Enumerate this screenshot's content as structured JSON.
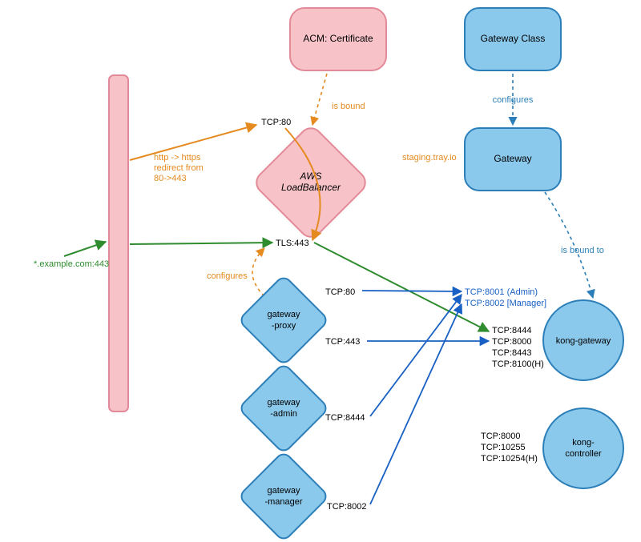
{
  "nodes": {
    "acm_cert": "ACM: Certificate",
    "aws_lb": "AWS\nLoadBalancer",
    "gateway_class": "Gateway Class",
    "gateway": "Gateway",
    "gateway_proxy": "gateway\n-proxy",
    "gateway_admin": "gateway\n-admin",
    "gateway_manager": "gateway\n-manager",
    "kong_gateway": "kong-gateway",
    "kong_controller": "kong-\ncontroller"
  },
  "ports": {
    "lb_tcp80": "TCP:80",
    "lb_tls443": "TLS:443",
    "proxy_tcp80": "TCP:80",
    "proxy_tcp443": "TCP:443",
    "admin_tcp8444": "TCP:8444",
    "manager_tcp8002": "TCP:8002",
    "kg_admin": "TCP:8001 (Admin)",
    "kg_manager": "TCP:8002 [Manager]",
    "kg_8444": "TCP:8444",
    "kg_8000": "TCP:8000",
    "kg_8443": "TCP:8443",
    "kg_8100": "TCP:8100(H)",
    "kc_8000": "TCP:8000",
    "kc_10255": "TCP:10255",
    "kc_10254": "TCP:10254(H)"
  },
  "labels": {
    "ingress": "*.example.com:443",
    "http_redirect": "http -> https\nredirect from\n80->443",
    "is_bound": "is bound",
    "configures_lb": "configures",
    "configures_gw": "configures",
    "staging": "staging.tray.io",
    "is_bound_to": "is bound to"
  },
  "colors": {
    "pink_fill": "#f7c3c9",
    "pink_stroke": "#e28a97",
    "blue_fill": "#8bc9ec",
    "blue_stroke": "#2c7fb8",
    "green": "#2e8b2e",
    "orange": "#e58a1f",
    "blue_line": "#1860c4",
    "black": "#000"
  }
}
